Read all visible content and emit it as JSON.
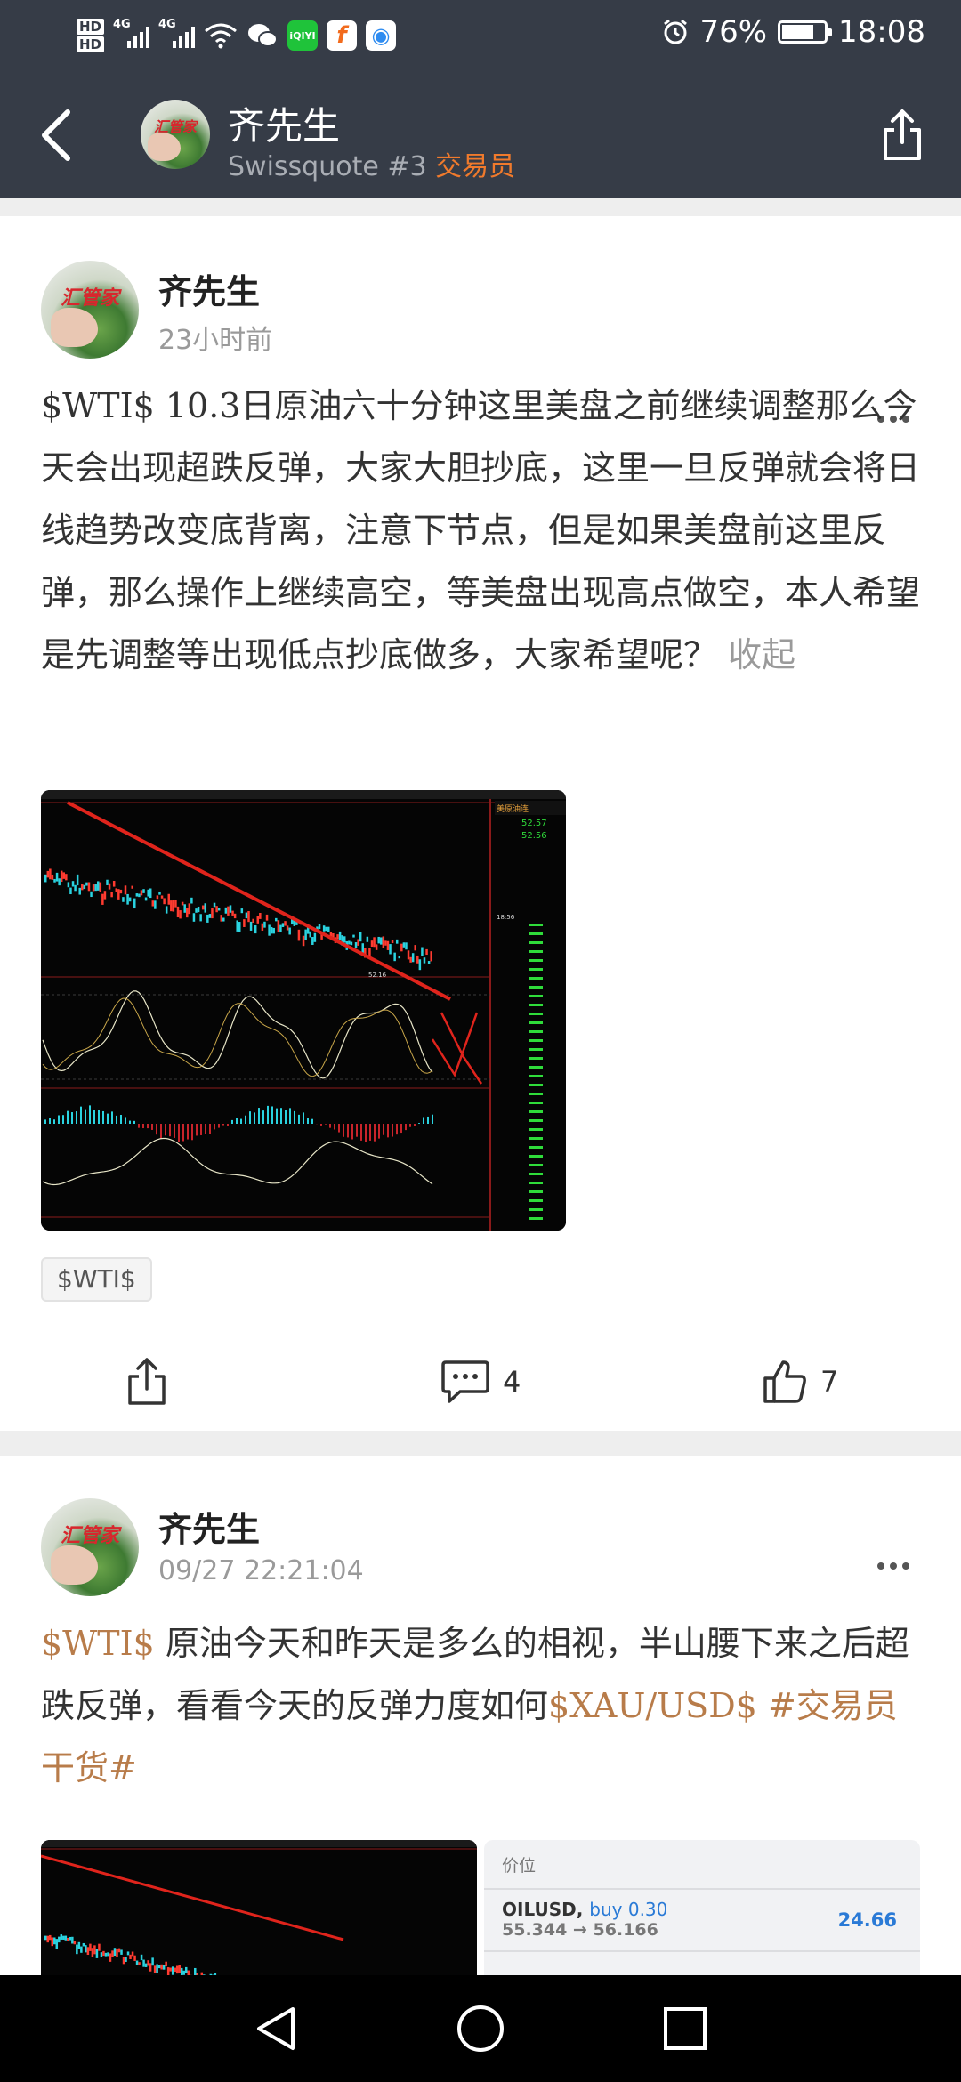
{
  "status_bar": {
    "hd_top": "HD",
    "hd_bottom": "HD",
    "net1": "4G",
    "net2": "4G",
    "battery_text": "76%",
    "battery_level": 0.76,
    "time": "18:08",
    "app_icons": [
      {
        "name": "iqiyi-icon",
        "label": "iQIYI",
        "color": "#1fc33a"
      },
      {
        "name": "app-f-icon",
        "label": "f",
        "color": "#f26b1d"
      },
      {
        "name": "browser-icon",
        "label": "◉",
        "color": "#2f8cf0"
      }
    ]
  },
  "header": {
    "name": "齐先生",
    "subtitle": "Swissquote #3 ",
    "role": "交易员",
    "avatar_logo": "汇管家"
  },
  "posts": [
    {
      "author": "齐先生",
      "time": "23小时前",
      "avatar_logo": "汇管家",
      "text_tag": "$WTI$",
      "text": " 10.3日原油六十分钟这里美盘之前继续调整那么今天会出现超跌反弹，大家大胆抄底，这里一旦反弹就会将日线趋势改变底背离，注意下节点，但是如果美盘前这里反弹，那么操作上继续高空，等美盘出现高点做空，本人希望是先调整等出现低点抄底做多，大家希望呢？ ",
      "collapse": "收起",
      "tag": "$WTI$",
      "comments": "4",
      "likes": "7"
    },
    {
      "author": "齐先生",
      "time": "09/27 22:21:04",
      "avatar_logo": "汇管家",
      "text_tag1": "$WTI$",
      "text": " 原油今天和昨天是多么的相视，半山腰下来之后超跌反弹，看看今天的反弹力度如何",
      "text_tag2": "$XAU/USD$",
      "text_tag3": " #交易员干货#"
    }
  ],
  "quote_panel": {
    "header": "价位",
    "symbol": "OILUSD, ",
    "buy": "buy 0.30",
    "range": "55.344 → 56.166",
    "price": "24.66"
  },
  "chart_labels": {
    "price_label": "52.16",
    "side_title": "美原油连",
    "side_sell": "52.57",
    "side_buy": "52.56",
    "side_time": "18:56"
  }
}
